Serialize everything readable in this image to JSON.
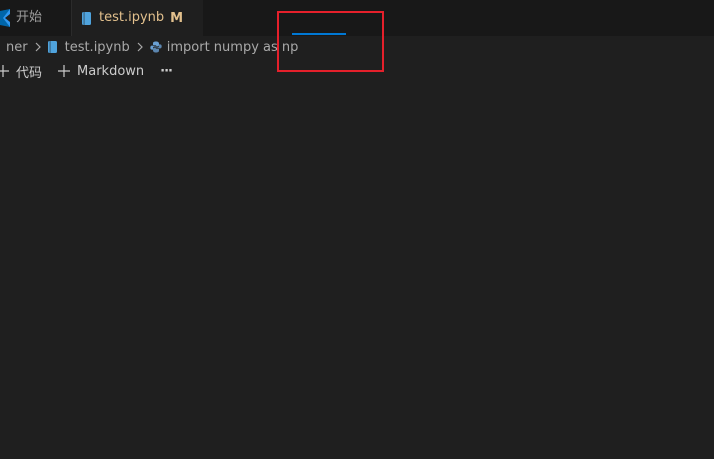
{
  "tabs": [
    {
      "label": "开始",
      "icon": "vscode-logo-icon",
      "active": false
    },
    {
      "label": "test.ipynb",
      "badge": "M",
      "icon": "notebook-icon",
      "active": true
    }
  ],
  "breadcrumb": {
    "items": [
      "ner",
      "test.ipynb",
      "import numpy as np"
    ],
    "icons": [
      "notebook-icon",
      "python-icon"
    ]
  },
  "toolbar": {
    "add_code_label": "代码",
    "add_markdown_label": "Markdown",
    "more_label": "···"
  },
  "colors": {
    "modified": "#e2c08d",
    "progress": "#0078d4",
    "highlight": "#e5202b",
    "vscode_blue": "#2f97f0"
  }
}
